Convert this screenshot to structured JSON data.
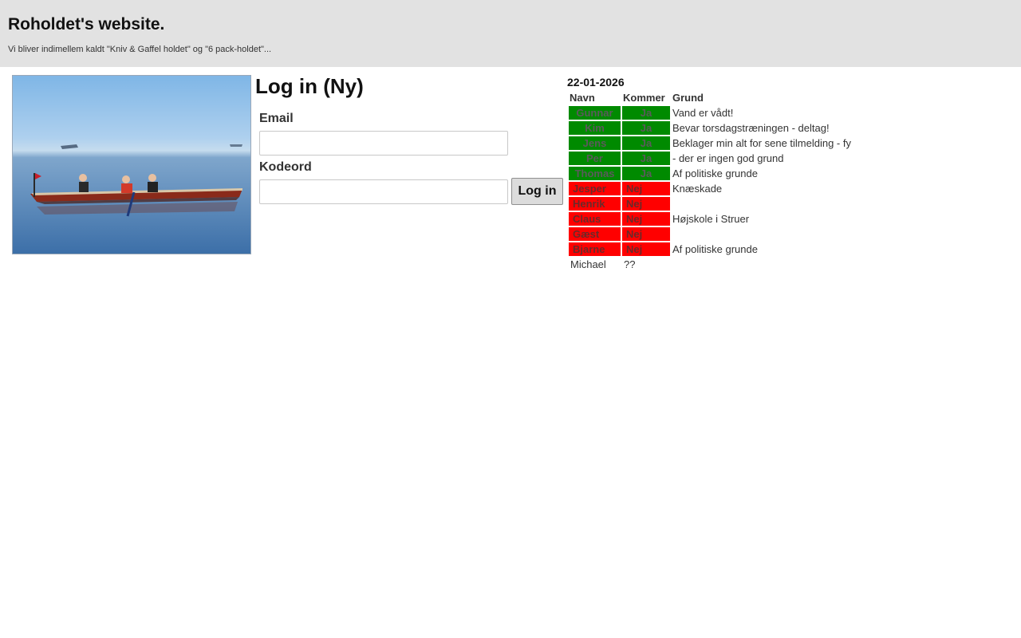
{
  "header": {
    "title": "Roholdet's website.",
    "subtitle": "Vi bliver indimellem kaldt \"Kniv & Gaffel holdet\" og \"6 pack-holdet\"..."
  },
  "login": {
    "heading": "Log in (Ny)",
    "email_label": "Email",
    "email_value": "",
    "password_label": "Kodeord",
    "password_value": "",
    "button_label": "Log in"
  },
  "attendance": {
    "date": "22-01-2026",
    "columns": [
      "Navn",
      "Kommer",
      "Grund"
    ],
    "rows": [
      {
        "name": "Gunnar",
        "kommer": "Ja",
        "grund": "Vand er vådt!",
        "status": "yes"
      },
      {
        "name": "Kim",
        "kommer": "Ja",
        "grund": "Bevar torsdagstræningen - deltag!",
        "status": "yes"
      },
      {
        "name": "Jens",
        "kommer": "Ja",
        "grund": "Beklager min alt for sene tilmelding - fy",
        "status": "yes"
      },
      {
        "name": "Per",
        "kommer": "Ja",
        "grund": "- der er ingen god grund",
        "status": "yes"
      },
      {
        "name": "Thomas",
        "kommer": "Ja",
        "grund": "Af politiske grunde",
        "status": "yes"
      },
      {
        "name": "Jesper",
        "kommer": "Nej",
        "grund": "Knæskade",
        "status": "no"
      },
      {
        "name": "Henrik",
        "kommer": "Nej",
        "grund": "",
        "status": "no"
      },
      {
        "name": "Claus",
        "kommer": "Nej",
        "grund": "Højskole i Struer",
        "status": "no"
      },
      {
        "name": "Gæst",
        "kommer": "Nej",
        "grund": "",
        "status": "no"
      },
      {
        "name": "Bjarne",
        "kommer": "Nej",
        "grund": "Af politiske grunde",
        "status": "no"
      },
      {
        "name": "Michael",
        "kommer": "??",
        "grund": "",
        "status": "unknown"
      }
    ]
  },
  "colors": {
    "header_bg": "#e2e2e2",
    "yes": "#008a00",
    "no": "#ff0000"
  },
  "icons": {
    "photo": "rowing-boat-photo"
  }
}
